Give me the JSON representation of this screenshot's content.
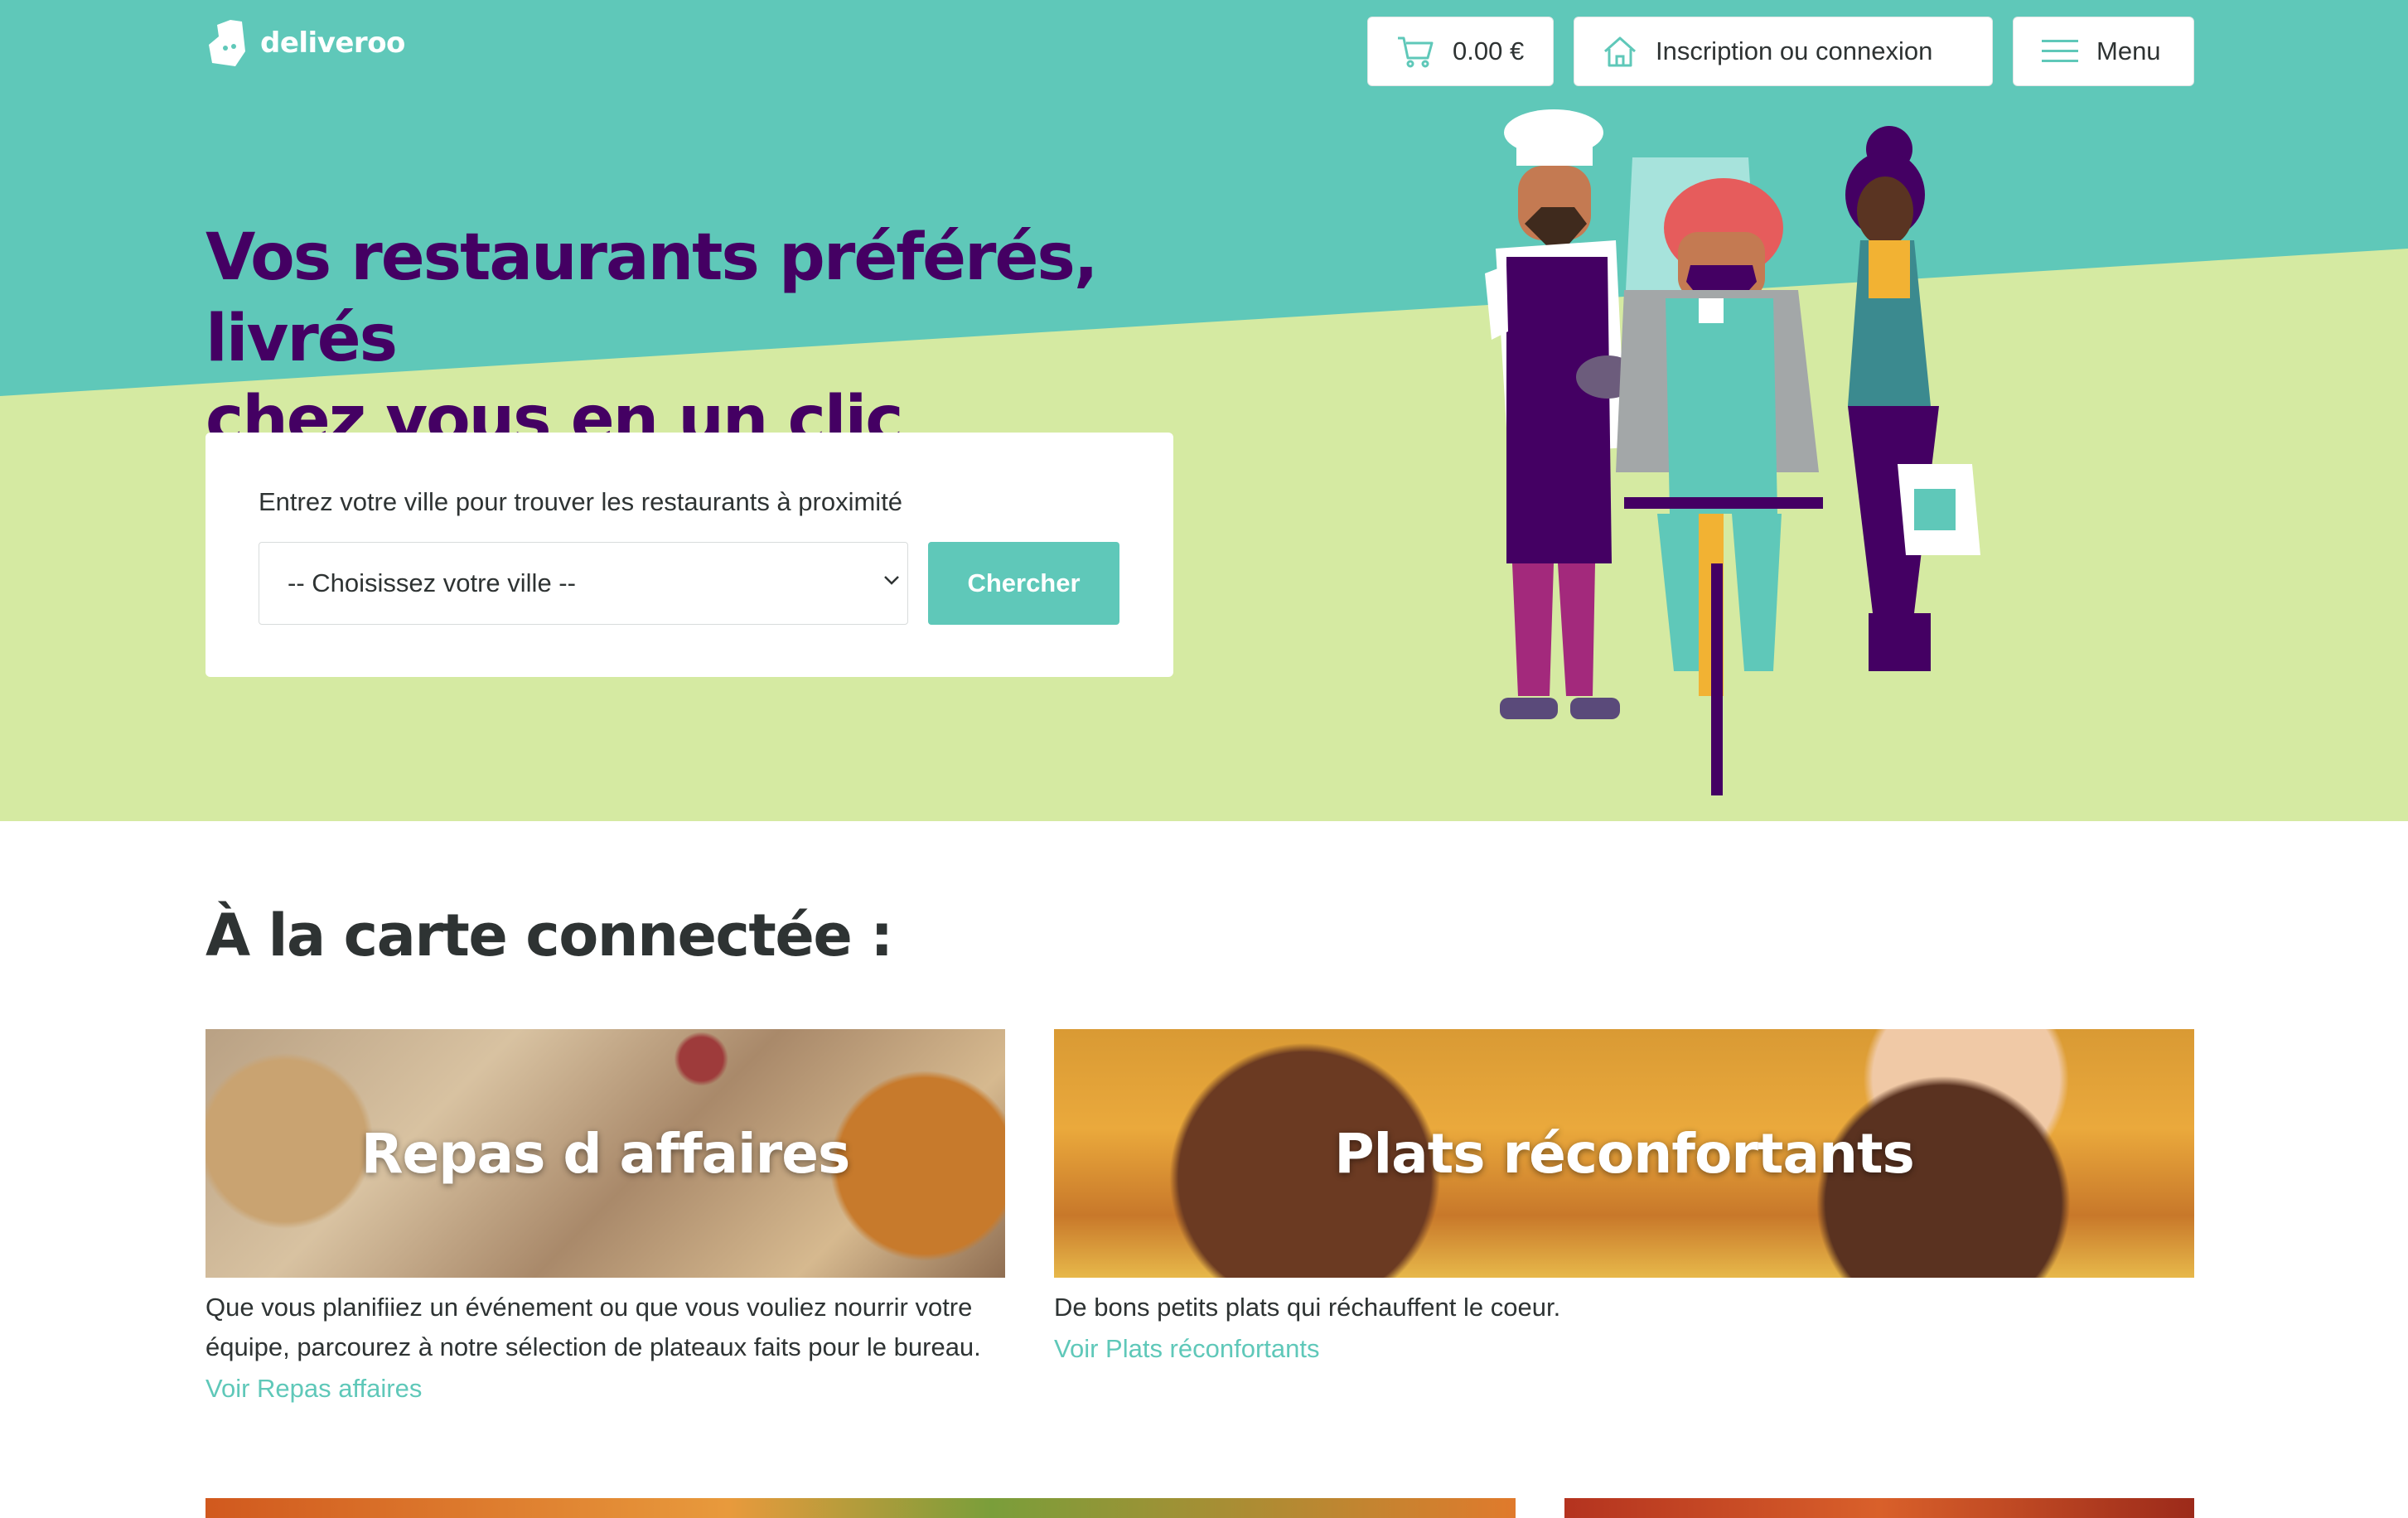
{
  "brand": {
    "name": "deliveroo",
    "colors": {
      "teal": "#5fc8b9",
      "purple": "#440063",
      "lime": "#d5eaa2",
      "dark_text": "#2e3333"
    }
  },
  "header": {
    "cart_total": "0.00 €",
    "login_label": "Inscription ou connexion",
    "menu_label": "Menu",
    "icons": {
      "cart": "cart-icon",
      "home": "home-icon",
      "menu": "hamburger-icon"
    }
  },
  "hero": {
    "headline_line1": "Vos restaurants préférés, livrés",
    "headline_line2": "chez vous en un clic",
    "search": {
      "label": "Entrez votre ville pour trouver les restaurants à proximité",
      "selected_city": "-- Choisissez votre ville --",
      "button_label": "Chercher"
    }
  },
  "collections": {
    "title": "À la carte connectée :",
    "cards": [
      {
        "image_title": "Repas d affaires",
        "description": "Que vous planifiiez un événement ou que vous vouliez nourrir votre équipe, parcourez à notre sélection de plateaux faits pour le bureau.",
        "link": "Voir Repas affaires"
      },
      {
        "image_title": "Plats réconfortants",
        "description": "De bons petits plats qui réchauffent le coeur.",
        "link": "Voir Plats réconfortants"
      }
    ]
  }
}
